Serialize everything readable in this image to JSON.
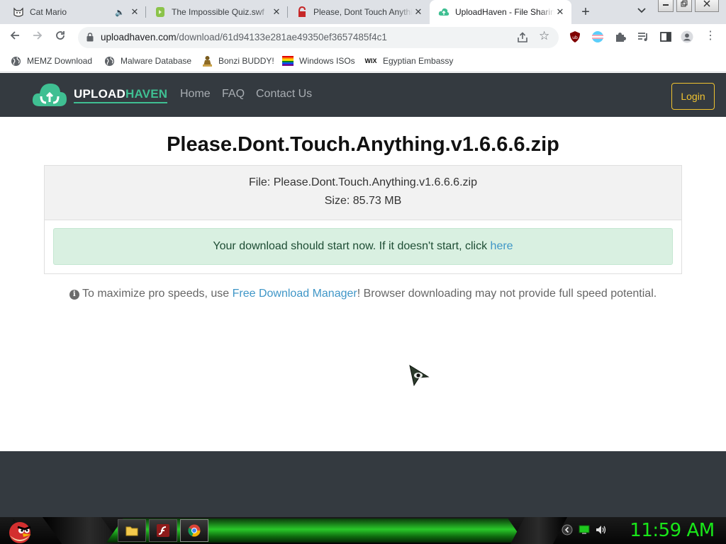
{
  "browser": {
    "tabs": [
      {
        "title": "Cat Mario",
        "active": false,
        "muted": true
      },
      {
        "title": "The Impossible Quiz.swf",
        "active": false
      },
      {
        "title": "Please, Dont Touch Anything",
        "active": false
      },
      {
        "title": "UploadHaven - File Sharing",
        "active": true
      }
    ],
    "new_tab_label": "+",
    "url_host": "uploadhaven.com",
    "url_path": "/download/61d94133e281ae49350ef3657485f4c1",
    "bookmarks": [
      {
        "label": "MEMZ Download",
        "icon": "globe-icon"
      },
      {
        "label": "Malware Database",
        "icon": "globe-icon"
      },
      {
        "label": "Bonzi BUDDY!",
        "icon": "bonzi-icon"
      },
      {
        "label": "Windows ISOs",
        "icon": "rainbow-flag-icon"
      },
      {
        "label": "Egyptian Embassy",
        "icon": "wix-icon"
      }
    ]
  },
  "site": {
    "logo_text_1": "UPLOAD",
    "logo_text_2": "HAVEN",
    "nav": [
      "Home",
      "FAQ",
      "Contact Us"
    ],
    "login_label": "Login",
    "file_title": "Please.Dont.Touch.Anything.v1.6.6.6.zip",
    "file_label": "File: Please.Dont.Touch.Anything.v1.6.6.6.zip",
    "size_label": "Size: 85.73 MB",
    "alert_text": "Your download should start now. If it doesn't start, click ",
    "alert_link": "here",
    "tip_before": " To maximize pro speeds, use ",
    "tip_link": "Free Download Manager",
    "tip_after": "! Browser downloading may not provide full speed potential."
  },
  "taskbar": {
    "clock": "11:59 AM"
  },
  "colors": {
    "site_nav_bg": "#343a40",
    "brand_green": "#3fbf92",
    "login_accent": "#f0c330",
    "alert_bg": "#d9f0e1",
    "link": "#3f96c7",
    "clock_green": "#19e619"
  }
}
